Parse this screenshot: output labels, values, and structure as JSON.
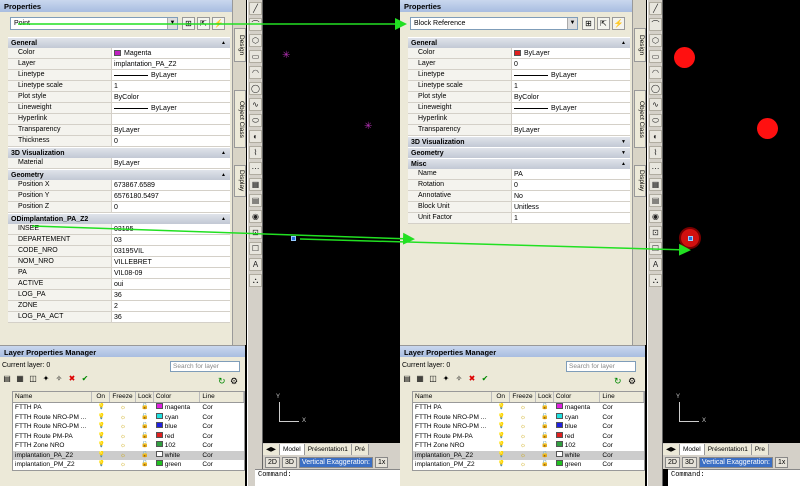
{
  "left": {
    "properties_title": "Properties",
    "selector_value": "Point",
    "sections": [
      {
        "title": "General",
        "collapsed": false,
        "rows": [
          {
            "key": "Color",
            "value": "Magenta",
            "swatch": "#c020c0"
          },
          {
            "key": "Layer",
            "value": "implantation_PA_Z2"
          },
          {
            "key": "Linetype",
            "value": "ByLayer",
            "line": true
          },
          {
            "key": "Linetype scale",
            "value": "1"
          },
          {
            "key": "Plot style",
            "value": "ByColor"
          },
          {
            "key": "Lineweight",
            "value": "ByLayer",
            "line": true
          },
          {
            "key": "Hyperlink",
            "value": ""
          },
          {
            "key": "Transparency",
            "value": "ByLayer"
          },
          {
            "key": "Thickness",
            "value": "0"
          }
        ]
      },
      {
        "title": "3D Visualization",
        "collapsed": false,
        "rows": [
          {
            "key": "Material",
            "value": "ByLayer"
          }
        ]
      },
      {
        "title": "Geometry",
        "collapsed": false,
        "rows": [
          {
            "key": "Position X",
            "value": "673867.6589"
          },
          {
            "key": "Position Y",
            "value": "6576180.5497"
          },
          {
            "key": "Position Z",
            "value": "0"
          }
        ]
      },
      {
        "title": "ODimplantation_PA_Z2",
        "collapsed": false,
        "rows": [
          {
            "key": "INSEE",
            "value": "03195"
          },
          {
            "key": "DEPARTEMENT",
            "value": "03"
          },
          {
            "key": "CODE_NRO",
            "value": "03195VIL"
          },
          {
            "key": "NOM_NRO",
            "value": "VILLEBRET"
          },
          {
            "key": "PA",
            "value": "VIL08-09"
          },
          {
            "key": "ACTIVE",
            "value": "oui"
          },
          {
            "key": "LOG_PA",
            "value": "36"
          },
          {
            "key": "ZONE",
            "value": "2"
          },
          {
            "key": "LOG_PA_ACT",
            "value": "36"
          }
        ]
      }
    ],
    "vtabs": [
      "Design",
      "Object Class",
      "Display"
    ],
    "layer_manager": {
      "title": "Layer Properties Manager",
      "current_layer": "Current layer: 0",
      "search_placeholder": "Search for layer",
      "headers": [
        "Name",
        "On",
        "Freeze",
        "Lock",
        "Color",
        "Line"
      ],
      "rows": [
        {
          "name": "FTTH PA",
          "color": "magenta",
          "hex": "#e020e0",
          "line": "Cor"
        },
        {
          "name": "FTTH Route NRO-PM ...",
          "color": "cyan",
          "hex": "#20e0e0",
          "line": "Cor"
        },
        {
          "name": "FTTH Route NRO-PM ...",
          "color": "blue",
          "hex": "#2020e0",
          "line": "Cor"
        },
        {
          "name": "FTTH Route PM-PA",
          "color": "red",
          "hex": "#e02020",
          "line": "Cor"
        },
        {
          "name": "FTTH Zone NRO",
          "color": "102",
          "hex": "#30a040",
          "line": "Cor"
        },
        {
          "name": "implantation_PA_Z2",
          "color": "white",
          "hex": "#ffffff",
          "line": "Cor",
          "selected": true
        },
        {
          "name": "implantation_PM_Z2",
          "color": "green",
          "hex": "#20c020",
          "line": "Cor"
        }
      ]
    },
    "model_tabs": [
      "Model",
      "Présentation1",
      "Pré"
    ],
    "status": {
      "btn2d": "2D",
      "btn3d": "3D",
      "vex": "Vertical Exaggeration:",
      "scale": "1x"
    },
    "command_label": "Command:"
  },
  "right": {
    "properties_title": "Properties",
    "selector_value": "Block Reference",
    "sections": [
      {
        "title": "General",
        "collapsed": false,
        "rows": [
          {
            "key": "Color",
            "value": "ByLayer",
            "swatch": "#e02020"
          },
          {
            "key": "Layer",
            "value": "0"
          },
          {
            "key": "Linetype",
            "value": "ByLayer",
            "line": true
          },
          {
            "key": "Linetype scale",
            "value": "1"
          },
          {
            "key": "Plot style",
            "value": "ByColor"
          },
          {
            "key": "Lineweight",
            "value": "ByLayer",
            "line": true
          },
          {
            "key": "Hyperlink",
            "value": ""
          },
          {
            "key": "Transparency",
            "value": "ByLayer"
          }
        ]
      },
      {
        "title": "3D Visualization",
        "collapsed": true,
        "rows": []
      },
      {
        "title": "Geometry",
        "collapsed": true,
        "rows": []
      },
      {
        "title": "Misc",
        "collapsed": false,
        "rows": [
          {
            "key": "Name",
            "value": "PA"
          },
          {
            "key": "Rotation",
            "value": "0"
          },
          {
            "key": "Annotative",
            "value": "No"
          },
          {
            "key": "Block Unit",
            "value": "Unitless"
          },
          {
            "key": "Unit Factor",
            "value": "1"
          }
        ]
      }
    ],
    "vtabs": [
      "Design",
      "Object Class",
      "Display"
    ],
    "layer_manager": {
      "title": "Layer Properties Manager",
      "current_layer": "Current layer: 0",
      "search_placeholder": "Search for layer",
      "headers": [
        "Name",
        "On",
        "Freeze",
        "Lock",
        "Color",
        "Line"
      ],
      "rows": [
        {
          "name": "FTTH PA",
          "color": "magenta",
          "hex": "#e020e0",
          "line": "Cor"
        },
        {
          "name": "FTTH Route NRO-PM ...",
          "color": "cyan",
          "hex": "#20e0e0",
          "line": "Cor"
        },
        {
          "name": "FTTH Route NRO-PM ...",
          "color": "blue",
          "hex": "#2020e0",
          "line": "Cor"
        },
        {
          "name": "FTTH Route PM-PA",
          "color": "red",
          "hex": "#e02020",
          "line": "Cor"
        },
        {
          "name": "FTTH Zone NRO",
          "color": "102",
          "hex": "#30a040",
          "line": "Cor"
        },
        {
          "name": "implantation_PA_Z2",
          "color": "white",
          "hex": "#ffffff",
          "line": "Cor",
          "selected": true
        },
        {
          "name": "implantation_PM_Z2",
          "color": "green",
          "hex": "#20c020",
          "line": "Cor"
        }
      ]
    },
    "model_tabs": [
      "Model",
      "Présentation1",
      "Pre"
    ],
    "status": {
      "btn2d": "2D",
      "btn3d": "3D",
      "vex": "Vertical Exaggeration:",
      "scale": "1x"
    },
    "command_label": "Command:"
  },
  "axis_labels": {
    "x": "X",
    "y": "Y"
  },
  "accent_arrow_color": "#22e022"
}
